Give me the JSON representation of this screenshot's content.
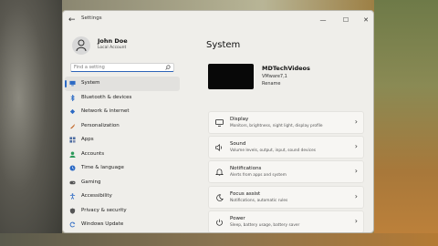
{
  "window": {
    "title": "Settings",
    "controls": {
      "minimize": "—",
      "maximize": "☐",
      "close": "✕"
    },
    "back": "←"
  },
  "account": {
    "name": "John Doe",
    "type": "Local Account"
  },
  "search": {
    "placeholder": "Find a setting"
  },
  "nav": [
    {
      "label": "System",
      "icon": "monitor-icon",
      "selected": true,
      "color": "#2c6ac4"
    },
    {
      "label": "Bluetooth & devices",
      "icon": "bluetooth-icon",
      "color": "#2c6ac4"
    },
    {
      "label": "Network & internet",
      "icon": "wifi-icon",
      "color": "#2c6ac4"
    },
    {
      "label": "Personalization",
      "icon": "brush-icon",
      "color": "#c46a2c"
    },
    {
      "label": "Apps",
      "icon": "apps-icon",
      "color": "#4a6aa0"
    },
    {
      "label": "Accounts",
      "icon": "person-icon",
      "color": "#2c9a5a"
    },
    {
      "label": "Time & language",
      "icon": "globe-clock-icon",
      "color": "#2c6ac4"
    },
    {
      "label": "Gaming",
      "icon": "gamepad-icon",
      "color": "#555555"
    },
    {
      "label": "Accessibility",
      "icon": "accessibility-icon",
      "color": "#2c6ac4"
    },
    {
      "label": "Privacy & security",
      "icon": "shield-icon",
      "color": "#555555"
    },
    {
      "label": "Windows Update",
      "icon": "update-icon",
      "color": "#2c6ac4"
    }
  ],
  "main": {
    "title": "System",
    "device": {
      "name": "MDTechVideos",
      "model": "VMware7,1",
      "rename": "Rename"
    },
    "cards": [
      {
        "title": "Display",
        "subtitle": "Monitors, brightness, night light, display profile",
        "icon": "display-icon"
      },
      {
        "title": "Sound",
        "subtitle": "Volume levels, output, input, sound devices",
        "icon": "speaker-icon"
      },
      {
        "title": "Notifications",
        "subtitle": "Alerts from apps and system",
        "icon": "bell-icon"
      },
      {
        "title": "Focus assist",
        "subtitle": "Notifications, automatic rules",
        "icon": "moon-icon"
      },
      {
        "title": "Power",
        "subtitle": "Sleep, battery usage, battery saver",
        "icon": "power-icon"
      }
    ],
    "chevron": "›"
  }
}
